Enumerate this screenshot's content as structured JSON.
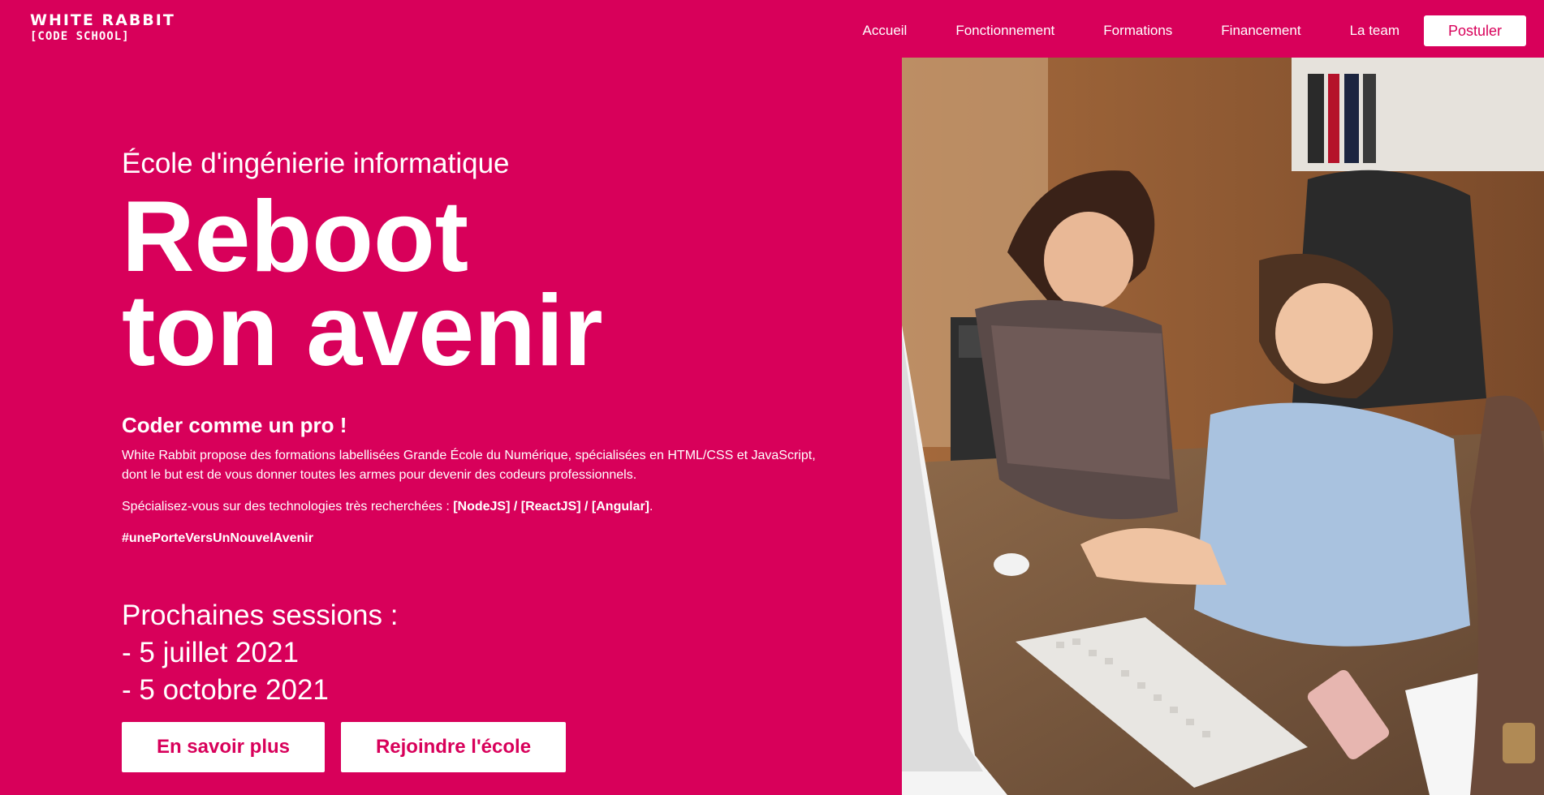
{
  "brand": {
    "name": "WHITE RABBIT",
    "sub": "[CODE SCHOOL]"
  },
  "nav": {
    "items": [
      "Accueil",
      "Fonctionnement",
      "Formations",
      "Financement",
      "La team"
    ],
    "cta": "Postuler"
  },
  "hero": {
    "eyebrow": "École d'ingénierie informatique",
    "headline_line1": "Reboot",
    "headline_line2": "ton avenir",
    "tagline": "Coder comme un pro !",
    "description": "White Rabbit propose des formations labellisées Grande École du Numérique, spécialisées en HTML/CSS et JavaScript, dont le but est de vous donner toutes les armes pour devenir des codeurs professionnels.",
    "spec_prefix": "Spécialisez-vous sur des technologies très recherchées : ",
    "spec_tech": "[NodeJS] / [ReactJS] / [Angular]",
    "spec_suffix": ".",
    "hashtag": "#unePorteVersUnNouvelAvenir",
    "sessions_title": "Prochaines sessions :",
    "sessions": [
      "- 5 juillet 2021",
      "- 5 octobre 2021"
    ],
    "button_more": "En savoir plus",
    "button_join": "Rejoindre l'école"
  },
  "colors": {
    "brand": "#d8005a",
    "text": "#ffffff"
  }
}
